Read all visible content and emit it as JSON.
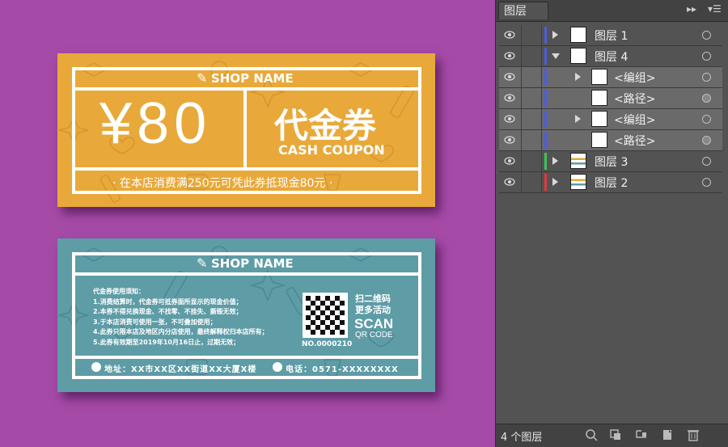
{
  "coupon_front": {
    "shop_name": "SHOP NAME",
    "amount": "¥80",
    "title": "代金券",
    "subtitle": "CASH COUPON",
    "condition": "· 在本店消费满250元可凭此券抵现金80元 ·"
  },
  "coupon_back": {
    "shop_name": "SHOP NAME",
    "rules": [
      "代金券使用须知：",
      "1.消费结算时，代金券可抵券面所显示的现金价值；",
      "2.本券不得兑换现金、不找零、不挂失、撕毁无效；",
      "3.于本店消费可使用一张，不可叠加使用；",
      "4.此券只限本店及地区内分店使用，最终解释权归本店所有；",
      "5.此券有效期至2019年10月16日止，过期无效；"
    ],
    "qr_number": "NO.0000210",
    "scan_cn_1": "扫二维码",
    "scan_cn_2": "更多活动",
    "scan_en": "SCAN",
    "qr_code_label": "QR CODE",
    "address": "地址：XX市XX区XX街道XX大厦X楼",
    "phone": "电话：0571-XXXXXXXX"
  },
  "panel": {
    "tab_title": "图层",
    "layer_count": "4 个图层",
    "layers": [
      {
        "name": "图层 1",
        "color": "#4b5de0",
        "expand": "collapsed",
        "indent": 0
      },
      {
        "name": "图层 4",
        "color": "#4b5de0",
        "expand": "expanded",
        "indent": 0
      },
      {
        "name": "<编组>",
        "color": "#4b5de0",
        "expand": "collapsed",
        "indent": 1
      },
      {
        "name": "<路径>",
        "color": "#4b5de0",
        "expand": "none",
        "indent": 1
      },
      {
        "name": "<编组>",
        "color": "#4b5de0",
        "expand": "collapsed",
        "indent": 1
      },
      {
        "name": "<路径>",
        "color": "#4b5de0",
        "expand": "none",
        "indent": 1
      },
      {
        "name": "图层 3",
        "color": "#3ec45a",
        "expand": "collapsed",
        "indent": 0
      },
      {
        "name": "图层 2",
        "color": "#e03a3a",
        "expand": "collapsed",
        "indent": 0
      }
    ]
  }
}
